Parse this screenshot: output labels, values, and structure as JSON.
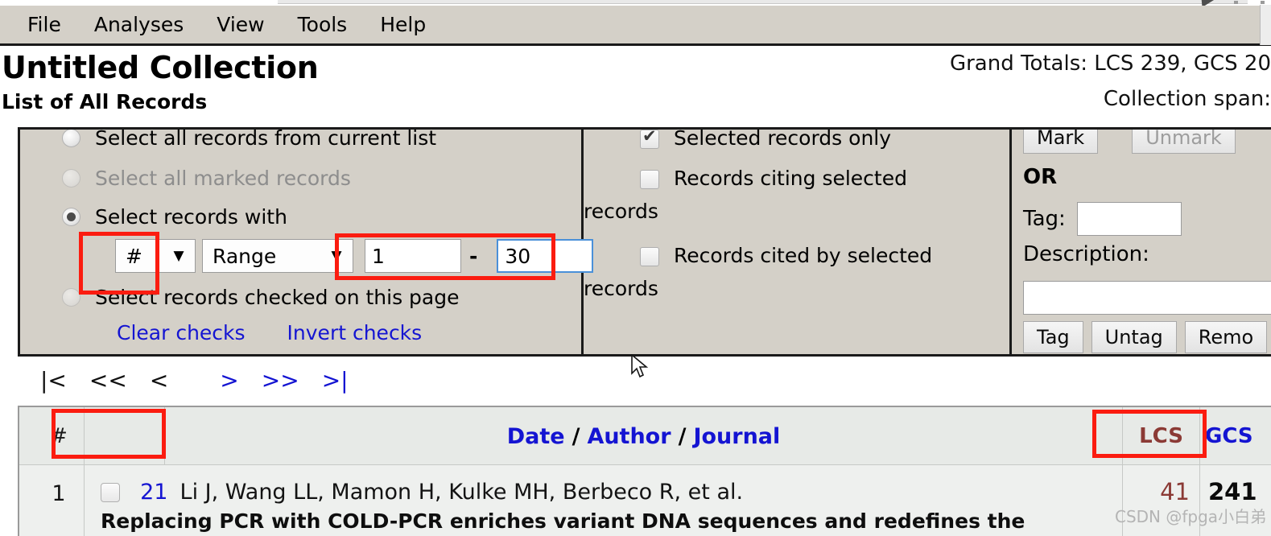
{
  "window": {
    "menu": [
      "File",
      "Analyses",
      "View",
      "Tools",
      "Help"
    ]
  },
  "header": {
    "collection_title": "Untitled Collection",
    "list_subtitle": "List of All Records",
    "grand_totals": "Grand Totals: LCS 239, GCS 20",
    "collection_span": "Collection span:"
  },
  "select_panel": {
    "options": [
      {
        "label": "Select all records from current list",
        "checked": false,
        "disabled": false
      },
      {
        "label": "Select all marked records",
        "checked": false,
        "disabled": true
      },
      {
        "label": "Select records with",
        "checked": true,
        "disabled": false
      },
      {
        "label": "Select records checked on this page",
        "checked": false,
        "disabled": false
      }
    ],
    "field_select": {
      "value": "#",
      "arrow": "▼"
    },
    "mode_select": {
      "value": "Range",
      "arrow": "▼"
    },
    "range_from": "1",
    "range_to": "30",
    "range_separator": "-",
    "links": [
      "Clear checks",
      "Invert checks"
    ]
  },
  "scope_panel": {
    "checkboxes": [
      {
        "label": "Selected records only",
        "checked": true,
        "wrap": ""
      },
      {
        "label": "Records citing selected",
        "checked": false,
        "wrap": "records"
      },
      {
        "label": "Records cited by selected",
        "checked": false,
        "wrap": "records"
      }
    ]
  },
  "mark_panel": {
    "mark_button": "Mark",
    "unmark_button": "Unmark",
    "or_label": "OR",
    "tag_label": "Tag:",
    "tag_value": "",
    "description_label": "Description:",
    "description_value": "",
    "tag_action": "Tag",
    "untag_action": "Untag",
    "remove_action": "Remo"
  },
  "pager": {
    "first": "|<",
    "prev_block": "<<",
    "prev": "<",
    "next": ">",
    "next_block": ">>",
    "last": ">|"
  },
  "table": {
    "headers": {
      "number": "#",
      "check": "",
      "date": "Date",
      "author": "Author",
      "journal": "Journal",
      "separator": "/",
      "lcs": "LCS",
      "gcs": "GCS"
    },
    "rows": [
      {
        "number": "1",
        "checked": false,
        "record_id": "21",
        "authors": "Li J, Wang LL, Mamon H, Kulke MH, Berbeco R, et al.",
        "title": "Replacing PCR with COLD-PCR enriches variant DNA sequences and redefines the",
        "lcs": "41",
        "gcs": "241"
      }
    ]
  },
  "watermark": {
    "text": "CSDN @fpga小白弟"
  },
  "colors": {
    "menu_bg": "#d4d0c8",
    "panel_bg": "#d4d0c8",
    "link_blue": "#1414d2",
    "lcs_maroon": "#8b3a35",
    "annotation_red": "#fb1c10",
    "table_header_bg": "#e7eae7",
    "focus_blue": "#4a90d9"
  }
}
